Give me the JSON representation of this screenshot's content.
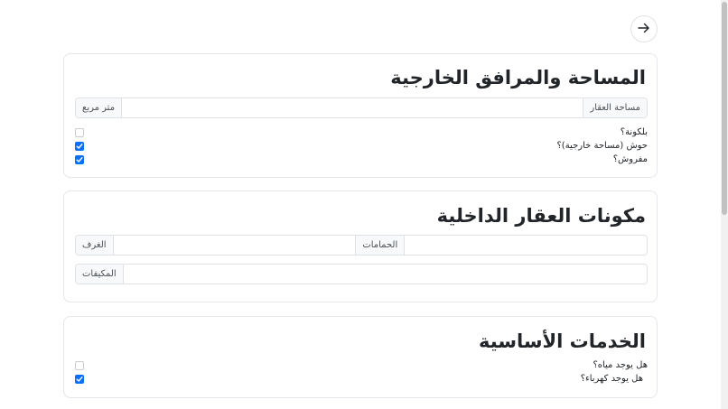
{
  "nav": {
    "back_icon": "arrow-right-icon"
  },
  "outdoor": {
    "title": "المساحة والمرافق الخارجية",
    "area_label": "مساحة العقار",
    "area_value": "",
    "area_unit": "متر مربع",
    "checks": [
      {
        "label": "بلكونة؟",
        "checked": false
      },
      {
        "label": "حوش (مساحة خارجية)؟",
        "checked": true
      },
      {
        "label": "مفروش؟",
        "checked": true
      }
    ]
  },
  "indoor": {
    "title": "مكونات العقار الداخلية",
    "bathrooms_label": "الحمامات",
    "bathrooms_value": "",
    "rooms_label": "الغرف",
    "rooms_value": "",
    "ac_label": "المكيفات",
    "ac_value": ""
  },
  "services": {
    "title": "الخدمات الأساسية",
    "checks": [
      {
        "label": "هل يوجد مياه؟",
        "checked": false
      },
      {
        "label": "هل يوجد كهرباء؟",
        "checked": true
      }
    ]
  },
  "colors": {
    "accent": "#0d6efd",
    "border": "#dee2e6",
    "addon_bg": "#f8f9fa"
  }
}
